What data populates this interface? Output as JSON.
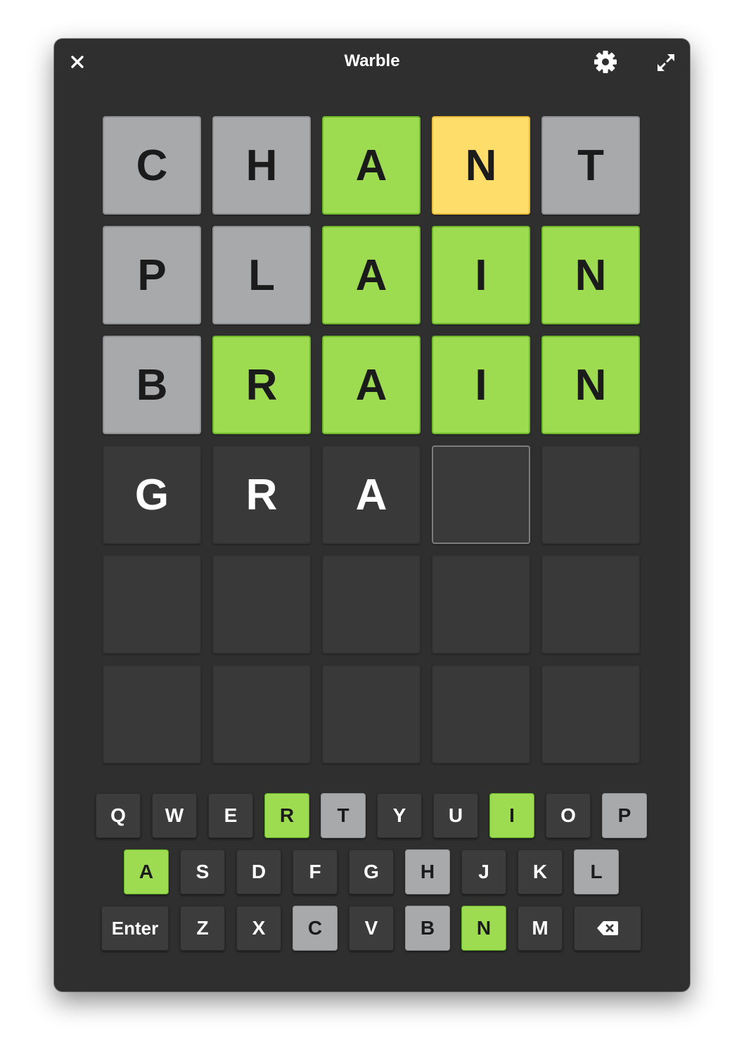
{
  "window": {
    "title": "Warble",
    "close_icon": "close-icon",
    "settings_icon": "gear-icon",
    "fullscreen_icon": "expand-icon"
  },
  "colors": {
    "background": "#2f2f2f",
    "correct": "#9ddb50",
    "present": "#ffdd6b",
    "absent": "#a8a9ab",
    "empty": "#393939"
  },
  "board": {
    "rows": [
      [
        {
          "letter": "C",
          "state": "absent"
        },
        {
          "letter": "H",
          "state": "absent"
        },
        {
          "letter": "A",
          "state": "correct"
        },
        {
          "letter": "N",
          "state": "present"
        },
        {
          "letter": "T",
          "state": "absent"
        }
      ],
      [
        {
          "letter": "P",
          "state": "absent"
        },
        {
          "letter": "L",
          "state": "absent"
        },
        {
          "letter": "A",
          "state": "correct"
        },
        {
          "letter": "I",
          "state": "correct"
        },
        {
          "letter": "N",
          "state": "correct"
        }
      ],
      [
        {
          "letter": "B",
          "state": "absent"
        },
        {
          "letter": "R",
          "state": "correct"
        },
        {
          "letter": "A",
          "state": "correct"
        },
        {
          "letter": "I",
          "state": "correct"
        },
        {
          "letter": "N",
          "state": "correct"
        }
      ],
      [
        {
          "letter": "G",
          "state": "typed"
        },
        {
          "letter": "R",
          "state": "typed"
        },
        {
          "letter": "A",
          "state": "typed"
        },
        {
          "letter": "",
          "state": "active"
        },
        {
          "letter": "",
          "state": "empty"
        }
      ],
      [
        {
          "letter": "",
          "state": "empty"
        },
        {
          "letter": "",
          "state": "empty"
        },
        {
          "letter": "",
          "state": "empty"
        },
        {
          "letter": "",
          "state": "empty"
        },
        {
          "letter": "",
          "state": "empty"
        }
      ],
      [
        {
          "letter": "",
          "state": "empty"
        },
        {
          "letter": "",
          "state": "empty"
        },
        {
          "letter": "",
          "state": "empty"
        },
        {
          "letter": "",
          "state": "empty"
        },
        {
          "letter": "",
          "state": "empty"
        }
      ]
    ]
  },
  "keyboard": {
    "rows": [
      [
        {
          "label": "Q",
          "state": "unused"
        },
        {
          "label": "W",
          "state": "unused"
        },
        {
          "label": "E",
          "state": "unused"
        },
        {
          "label": "R",
          "state": "correct"
        },
        {
          "label": "T",
          "state": "absent"
        },
        {
          "label": "Y",
          "state": "unused"
        },
        {
          "label": "U",
          "state": "unused"
        },
        {
          "label": "I",
          "state": "correct"
        },
        {
          "label": "O",
          "state": "unused"
        },
        {
          "label": "P",
          "state": "absent"
        }
      ],
      [
        {
          "label": "A",
          "state": "correct"
        },
        {
          "label": "S",
          "state": "unused"
        },
        {
          "label": "D",
          "state": "unused"
        },
        {
          "label": "F",
          "state": "unused"
        },
        {
          "label": "G",
          "state": "unused"
        },
        {
          "label": "H",
          "state": "absent"
        },
        {
          "label": "J",
          "state": "unused"
        },
        {
          "label": "K",
          "state": "unused"
        },
        {
          "label": "L",
          "state": "absent"
        }
      ],
      [
        {
          "label": "Enter",
          "state": "unused",
          "kind": "enter"
        },
        {
          "label": "Z",
          "state": "unused"
        },
        {
          "label": "X",
          "state": "unused"
        },
        {
          "label": "C",
          "state": "absent"
        },
        {
          "label": "V",
          "state": "unused"
        },
        {
          "label": "B",
          "state": "absent"
        },
        {
          "label": "N",
          "state": "correct"
        },
        {
          "label": "M",
          "state": "unused"
        },
        {
          "label": "",
          "state": "unused",
          "kind": "backspace",
          "icon": "backspace-icon"
        }
      ]
    ]
  }
}
